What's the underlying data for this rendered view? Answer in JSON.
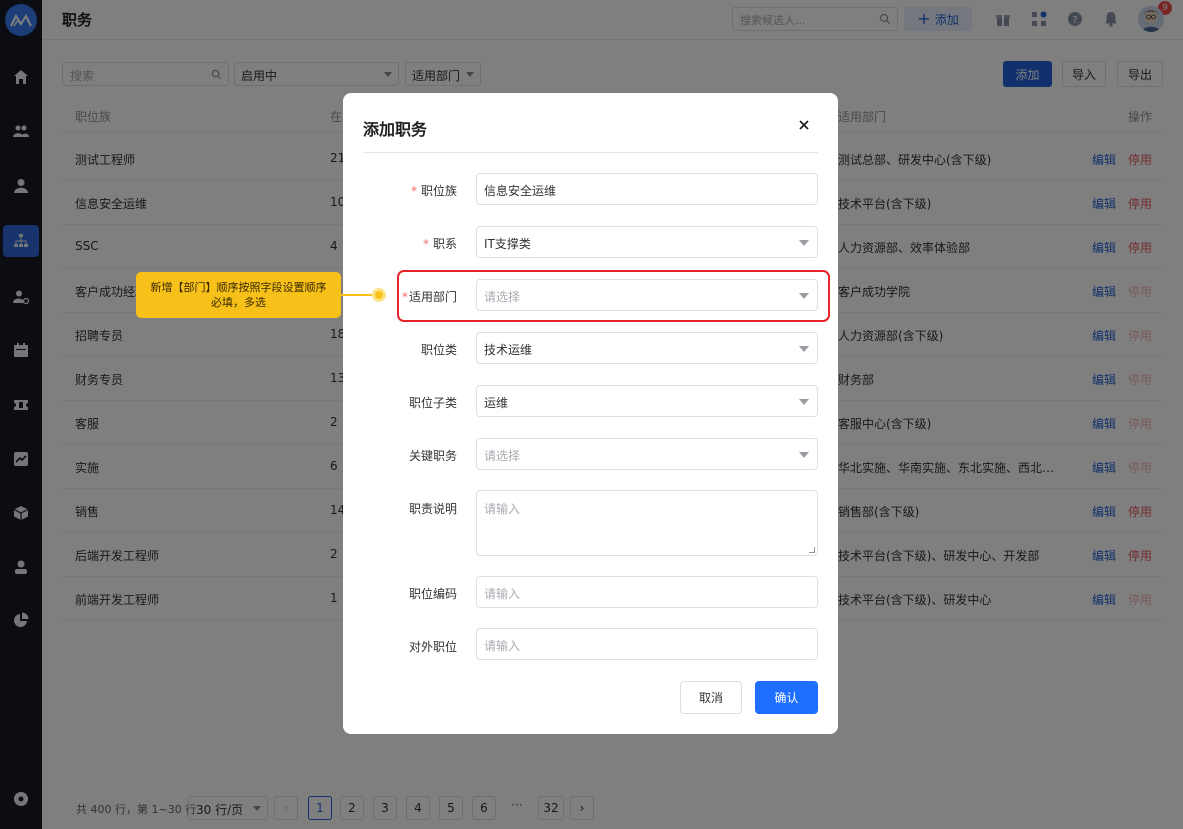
{
  "header": {
    "title": "职务",
    "search_placeholder": "搜索候选人...",
    "add_label": "添加",
    "notification_count": "9"
  },
  "toolbar": {
    "search_placeholder": "搜索",
    "status_value": "启用中",
    "dept_filter": "适用部门",
    "add_label": "添加",
    "import_label": "导入",
    "export_label": "导出"
  },
  "table": {
    "columns": {
      "family": "职位族",
      "count": "在",
      "dept": "适用部门",
      "ops": "操作"
    },
    "edit_label": "编辑",
    "disable_label": "停用",
    "rows": [
      {
        "family": "测试工程师",
        "count": "21",
        "dept": "测试总部、研发中心(含下级)",
        "disable_enabled": true
      },
      {
        "family": "信息安全运维",
        "count": "10",
        "dept": "技术平台(含下级)",
        "disable_enabled": true
      },
      {
        "family": "SSC",
        "count": "4",
        "dept": "人力资源部、效率体验部",
        "disable_enabled": true
      },
      {
        "family": "客户成功经理",
        "count": "",
        "dept": "客户成功学院",
        "disable_enabled": false
      },
      {
        "family": "招聘专员",
        "count": "18",
        "dept": "人力资源部(含下级)",
        "disable_enabled": false
      },
      {
        "family": "财务专员",
        "count": "13",
        "dept": "财务部",
        "disable_enabled": false
      },
      {
        "family": "客服",
        "count": "2",
        "dept": "客服中心(含下级)",
        "disable_enabled": false
      },
      {
        "family": "实施",
        "count": "6",
        "dept": "华北实施、华南实施、东北实施、西北实...",
        "disable_enabled": false
      },
      {
        "family": "销售",
        "count": "14",
        "dept": "销售部(含下级)",
        "disable_enabled": true
      },
      {
        "family": "后端开发工程师",
        "count": "2",
        "dept": "技术平台(含下级)、研发中心、开发部",
        "disable_enabled": true
      },
      {
        "family": "前端开发工程师",
        "count": "1",
        "dept": "技术平台(含下级)、研发中心",
        "disable_enabled": false
      }
    ]
  },
  "pagination": {
    "total_text": "共 400 行，第 1~30 行",
    "page_size": "30 行/页",
    "pages": [
      "1",
      "2",
      "3",
      "4",
      "5",
      "6"
    ],
    "ellipsis": "···",
    "last_page": "32",
    "current_page": "1"
  },
  "modal": {
    "title": "添加职务",
    "fields": {
      "family_label": "职位族",
      "family_value": "信息安全运维",
      "series_label": "职系",
      "series_value": "IT支撑类",
      "dept_label": "适用部门",
      "dept_placeholder": "请选择",
      "category_label": "职位类",
      "category_value": "技术运维",
      "subcategory_label": "职位子类",
      "subcategory_value": "运维",
      "key_label": "关键职务",
      "key_placeholder": "请选择",
      "desc_label": "职责说明",
      "desc_placeholder": "请输入",
      "code_label": "职位编码",
      "code_placeholder": "请输入",
      "external_label": "对外职位",
      "external_placeholder": "请输入"
    },
    "required_mark": "*",
    "cancel_label": "取消",
    "confirm_label": "确认"
  },
  "annotation": {
    "line1": "新增【部门】顺序按照字段设置顺序",
    "line2": "必填，多选",
    "color": "#f7c11a",
    "highlight_color": "#e5242b"
  },
  "icons": {
    "sidebar": [
      "home-icon",
      "users-icon",
      "user-icon",
      "org-chart-icon",
      "user-settings-icon",
      "calendar-icon",
      "ticket-icon",
      "report-icon",
      "cube-icon",
      "person-icon",
      "pie-chart-icon",
      "settings-icon"
    ]
  }
}
